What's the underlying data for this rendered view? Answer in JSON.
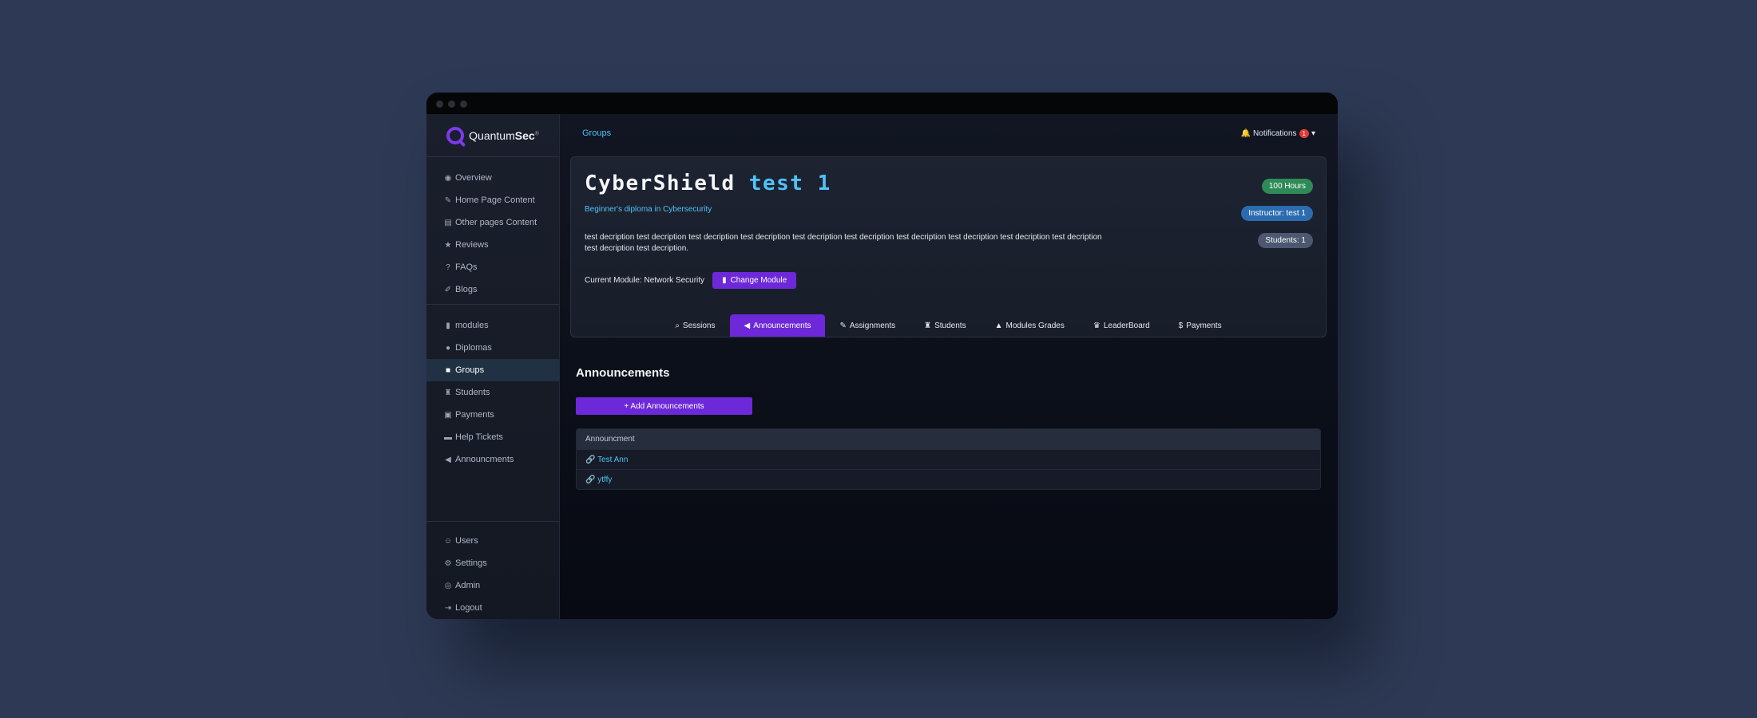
{
  "brand": {
    "name_regular": "Quantum",
    "name_bold": "Sec",
    "sup": "®"
  },
  "sidebar": {
    "group1": [
      {
        "icon": "◉",
        "label": "Overview"
      },
      {
        "icon": "✎",
        "label": "Home Page Content"
      },
      {
        "icon": "▤",
        "label": "Other pages Content"
      },
      {
        "icon": "★",
        "label": "Reviews"
      },
      {
        "icon": "?",
        "label": "FAQs"
      },
      {
        "icon": "✐",
        "label": "Blogs"
      }
    ],
    "group2": [
      {
        "icon": "▮",
        "label": "modules"
      },
      {
        "icon": "●",
        "label": "Diplomas"
      },
      {
        "icon": "■",
        "label": "Groups"
      },
      {
        "icon": "♜",
        "label": "Students"
      },
      {
        "icon": "▣",
        "label": "Payments"
      },
      {
        "icon": "▬",
        "label": "Help Tickets"
      },
      {
        "icon": "◀",
        "label": "Announcments"
      }
    ],
    "bottom": [
      {
        "icon": "☺",
        "label": "Users"
      },
      {
        "icon": "⚙",
        "label": "Settings"
      },
      {
        "icon": "◎",
        "label": "Admin"
      },
      {
        "icon": "⇥",
        "label": "Logout"
      }
    ]
  },
  "topbar": {
    "breadcrumb": "Groups",
    "notifications_label": "Notifications",
    "notifications_count": "1"
  },
  "group": {
    "title_main": "CyberShield",
    "title_accent": "test 1",
    "diploma": "Beginner's diploma in Cybersecurity",
    "description": "test decription test decription test decription test decription test decription test decription test decription test decription test decription test decription test decription test decription.",
    "current_module_label": "Current Module: Network Security",
    "change_module_label": "Change Module",
    "hours_badge": "100 Hours",
    "instructor_badge": "Instructor: test 1",
    "students_badge": "Students: 1"
  },
  "tabs": [
    {
      "icon": "⌕",
      "label": "Sessions"
    },
    {
      "icon": "◀",
      "label": "Announcements"
    },
    {
      "icon": "✎",
      "label": "Assignments"
    },
    {
      "icon": "♜",
      "label": "Students"
    },
    {
      "icon": "▲",
      "label": "Modules Grades"
    },
    {
      "icon": "♛",
      "label": "LeaderBoard"
    },
    {
      "icon": "$",
      "label": "Payments"
    }
  ],
  "announcements": {
    "heading": "Announcements",
    "add_button": "+ Add Announcements",
    "column_header": "Announcment",
    "rows": [
      {
        "link_icon": "🔗",
        "title": "Test Ann"
      },
      {
        "link_icon": "🔗",
        "title": "ytffy"
      }
    ]
  },
  "colors": {
    "accent": "#6d28d9",
    "link": "#4fc3f7",
    "badge_green": "#2e8b57",
    "badge_blue": "#2b6cb0",
    "badge_grey": "#4b5870"
  }
}
